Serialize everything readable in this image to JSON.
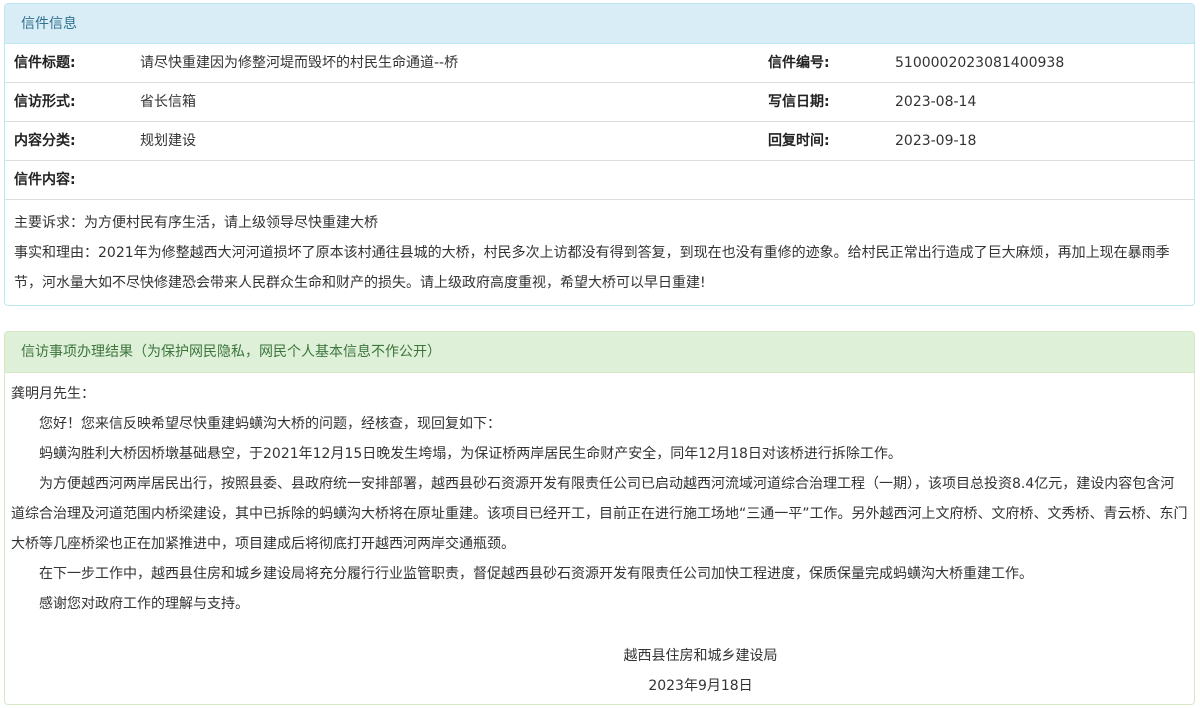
{
  "letter_panel": {
    "heading": "信件信息",
    "rows": [
      {
        "l1": "信件标题:",
        "v1": "请尽快重建因为修整河堤而毁坏的村民生命通道--桥",
        "l2": "信件编号:",
        "v2": "5100002023081400938"
      },
      {
        "l1": "信访形式:",
        "v1": "省长信箱",
        "l2": "写信日期:",
        "v2": "2023-08-14"
      },
      {
        "l1": "内容分类:",
        "v1": "规划建设",
        "l2": "回复时间:",
        "v2": "2023-09-18"
      }
    ],
    "content_label": "信件内容:",
    "content_lines": [
      "主要诉求：为方便村民有序生活，请上级领导尽快重建大桥",
      "事实和理由：2021年为修整越西大河河道损坏了原本该村通往县城的大桥，村民多次上访都没有得到答复，到现在也没有重修的迹象。给村民正常出行造成了巨大麻烦，再加上现在暴雨季节，河水量大如不尽快修建恐会带来人民群众生命和财产的损失。请上级政府高度重视，希望大桥可以早日重建!"
    ]
  },
  "result_panel": {
    "heading": "信访事项办理结果（为保护网民隐私，网民个人基本信息不作公开）",
    "salutation": "龚明月先生：",
    "paragraphs": [
      "您好！您来信反映希望尽快重建蚂蟥沟大桥的问题，经核查，现回复如下：",
      "蚂蟥沟胜利大桥因桥墩基础悬空，于2021年12月15日晚发生垮塌，为保证桥两岸居民生命财产安全，同年12月18日对该桥进行拆除工作。",
      "为方便越西河两岸居民出行，按照县委、县政府统一安排部署，越西县砂石资源开发有限责任公司已启动越西河流域河道综合治理工程（一期），该项目总投资8.4亿元，建设内容包含河道综合治理及河道范围内桥梁建设，其中已拆除的蚂蟥沟大桥将在原址重建。该项目已经开工，目前正在进行施工场地“三通一平”工作。另外越西河上文府桥、文府桥、文秀桥、青云桥、东门大桥等几座桥梁也正在加紧推进中，项目建成后将彻底打开越西河两岸交通瓶颈。",
      "在下一步工作中，越西县住房和城乡建设局将充分履行行业监管职责，督促越西县砂石资源开发有限责任公司加快工程进度，保质保量完成蚂蟥沟大桥重建工作。",
      "感谢您对政府工作的理解与支持。"
    ],
    "signature_org": "越西县住房和城乡建设局",
    "signature_date": "2023年9月18日"
  }
}
